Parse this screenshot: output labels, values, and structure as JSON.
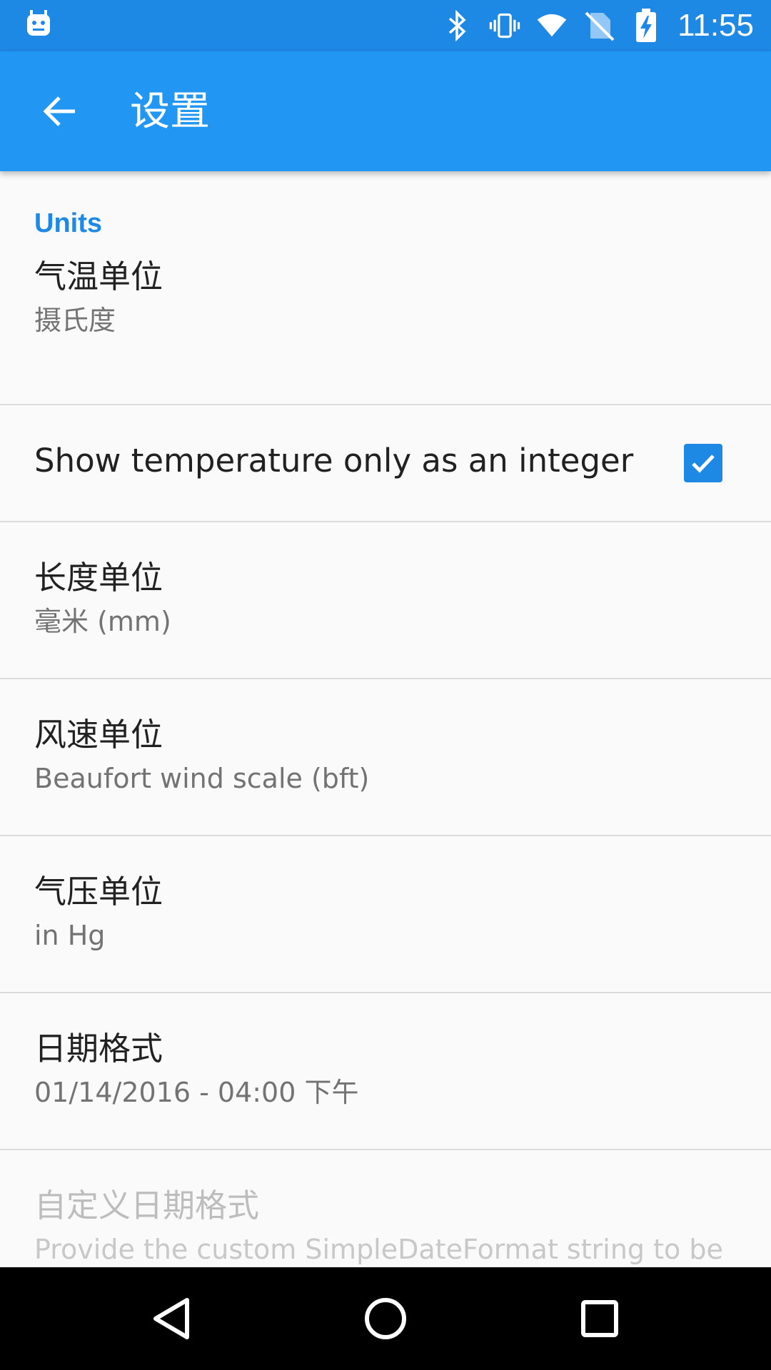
{
  "status_bar": {
    "time": "11:55",
    "icons": [
      "android-notification-icon",
      "bluetooth-icon",
      "vibrate-icon",
      "wifi-icon",
      "no-sim-icon",
      "battery-charging-icon"
    ]
  },
  "app_bar": {
    "title": "设置",
    "back_icon": "arrow-back-icon"
  },
  "settings": {
    "category_units": "Units",
    "temperature": {
      "title": "气温单位",
      "summary": "摄氏度"
    },
    "integer_temp": {
      "title": "Show temperature only as an integer",
      "checked": true
    },
    "length": {
      "title": "长度单位",
      "summary": "毫米 (mm)"
    },
    "wind": {
      "title": "风速单位",
      "summary": "Beaufort wind scale (bft)"
    },
    "pressure": {
      "title": "气压单位",
      "summary": "in Hg"
    },
    "date_format": {
      "title": "日期格式",
      "summary": "01/14/2016 - 04:00 下午"
    },
    "custom_date_format": {
      "title": "自定义日期格式",
      "summary": "Provide the custom SimpleDateFormat string to be"
    }
  },
  "nav_bar": {
    "back_icon": "nav-back-icon",
    "home_icon": "nav-home-icon",
    "recents_icon": "nav-recents-icon"
  },
  "colors": {
    "status_bar": "#1e88e5",
    "app_bar": "#2196f3",
    "accent": "#1e88e5"
  }
}
